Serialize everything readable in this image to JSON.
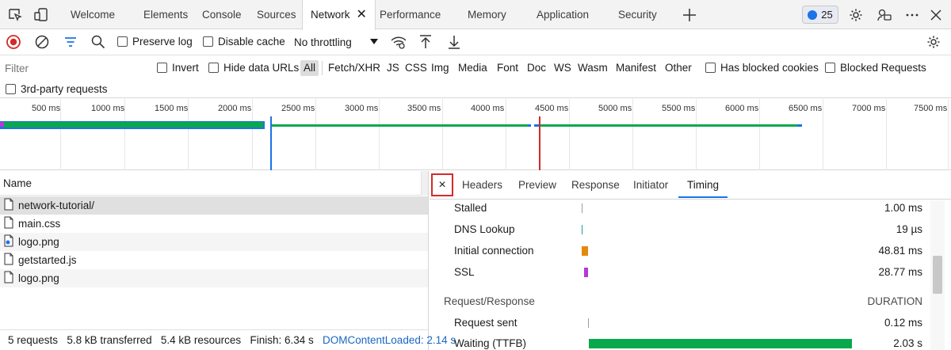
{
  "tabs": [
    {
      "label": "Welcome"
    },
    {
      "label": "Elements"
    },
    {
      "label": "Console"
    },
    {
      "label": "Sources"
    },
    {
      "label": "Network"
    },
    {
      "label": "Performance"
    },
    {
      "label": "Memory"
    },
    {
      "label": "Application"
    },
    {
      "label": "Security"
    }
  ],
  "issues_badge": {
    "count": "25"
  },
  "toolbar": {
    "preserve_log": "Preserve log",
    "disable_cache": "Disable cache",
    "throttling": "No throttling"
  },
  "filter": {
    "placeholder": "Filter",
    "invert": "Invert",
    "hide_data_urls": "Hide data URLs",
    "types": [
      "All",
      "Fetch/XHR",
      "JS",
      "CSS",
      "Img",
      "Media",
      "Font",
      "Doc",
      "WS",
      "Wasm",
      "Manifest",
      "Other"
    ],
    "has_blocked_cookies": "Has blocked cookies",
    "blocked_requests": "Blocked Requests",
    "third_party": "3rd-party requests"
  },
  "overview": {
    "ticks": [
      "500 ms",
      "1000 ms",
      "1500 ms",
      "2000 ms",
      "2500 ms",
      "3000 ms",
      "3500 ms",
      "4000 ms",
      "4500 ms",
      "5000 ms",
      "5500 ms",
      "6000 ms",
      "6500 ms",
      "7000 ms",
      "7500 ms"
    ]
  },
  "requests": {
    "header": "Name",
    "items": [
      {
        "name": "network-tutorial/"
      },
      {
        "name": "main.css"
      },
      {
        "name": "logo.png"
      },
      {
        "name": "getstarted.js"
      },
      {
        "name": "logo.png"
      }
    ]
  },
  "status": {
    "requests": "5 requests",
    "transferred": "5.8 kB transferred",
    "resources": "5.4 kB resources",
    "finish": "Finish: 6.34 s",
    "dom_content_loaded": "DOMContentLoaded: 2.14 s"
  },
  "detail": {
    "close": "×",
    "tabs": [
      "Headers",
      "Preview",
      "Response",
      "Initiator",
      "Timing"
    ],
    "timing": [
      {
        "label": "Stalled",
        "value": "1.00 ms",
        "color": "#9e9e9e"
      },
      {
        "label": "DNS Lookup",
        "value": "19 µs",
        "color": "#1f9aa8"
      },
      {
        "label": "Initial connection",
        "value": "48.81 ms",
        "color": "#e38a0b"
      },
      {
        "label": "SSL",
        "value": "28.77 ms",
        "color": "#b33ad8"
      }
    ],
    "section": {
      "title": "Request/Response",
      "duration": "DURATION"
    },
    "reqres": [
      {
        "label": "Request sent",
        "value": "0.12 ms",
        "color": "#9e9e9e"
      },
      {
        "label": "Waiting (TTFB)",
        "value": "2.03 s",
        "color": "#0aa84c"
      }
    ]
  },
  "colors": {
    "accent": "#1a73e8",
    "record": "#d42a2a",
    "green": "#0aa84c"
  }
}
